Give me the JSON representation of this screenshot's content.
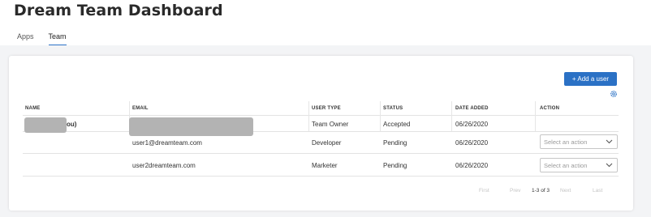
{
  "page": {
    "title": "Dream Team Dashboard"
  },
  "tabs": [
    {
      "label": "Apps",
      "active": false
    },
    {
      "label": "Team",
      "active": true
    }
  ],
  "team": {
    "add_user_label": "+ Add a user",
    "settings_icon": "gear-icon",
    "columns": [
      "NAME",
      "EMAIL",
      "USER TYPE",
      "STATUS",
      "DATE ADDED",
      "ACTION"
    ],
    "rows": [
      {
        "name": "ou)",
        "email": "",
        "user_type": "Team Owner",
        "status": "Accepted",
        "date_added": "06/26/2020",
        "action": ""
      },
      {
        "name": "",
        "email": "user1@dreamteam.com",
        "user_type": "Developer",
        "status": "Pending",
        "date_added": "06/26/2020",
        "action": "Select an action"
      },
      {
        "name": "",
        "email": "user2dreamteam.com",
        "user_type": "Marketer",
        "status": "Pending",
        "date_added": "06/26/2020",
        "action": "Select an action"
      }
    ],
    "pagination": {
      "first": "First",
      "prev": "Prev",
      "count": "1-3 of 3",
      "next": "Next",
      "last": "Last"
    }
  },
  "colors": {
    "accent": "#2b71c5",
    "background": "#f3f4f6",
    "redaction": "#b3b3b3"
  }
}
